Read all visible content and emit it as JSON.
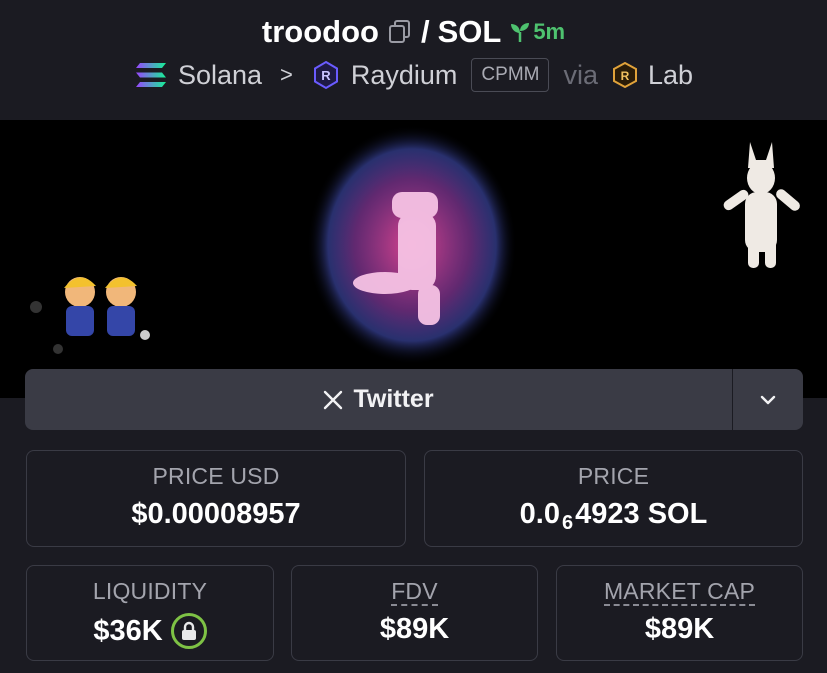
{
  "header": {
    "token_name": "troodoo",
    "slash": "/",
    "quote_symbol": "SOL",
    "age": "5m"
  },
  "chain": {
    "chain_name": "Solana",
    "separator": ">",
    "dex_name": "Raydium",
    "pool_type": "CPMM",
    "via_label": "via",
    "launchpad_name": "Lab"
  },
  "social": {
    "twitter_label": "Twitter"
  },
  "stats": {
    "price_usd_label": "PRICE USD",
    "price_usd_value": "$0.00008957",
    "price_label": "PRICE",
    "price_prefix": "0.0",
    "price_zero_count": "6",
    "price_suffix": "4923 SOL",
    "liquidity_label": "LIQUIDITY",
    "liquidity_value": "$36K",
    "fdv_label": "FDV",
    "fdv_value": "$89K",
    "mcap_label": "MARKET CAP",
    "mcap_value": "$89K"
  },
  "colors": {
    "background": "#1b1b22",
    "age_green": "#4ec26f",
    "lock_green": "#7ec245",
    "card_border": "#3a3b45"
  }
}
